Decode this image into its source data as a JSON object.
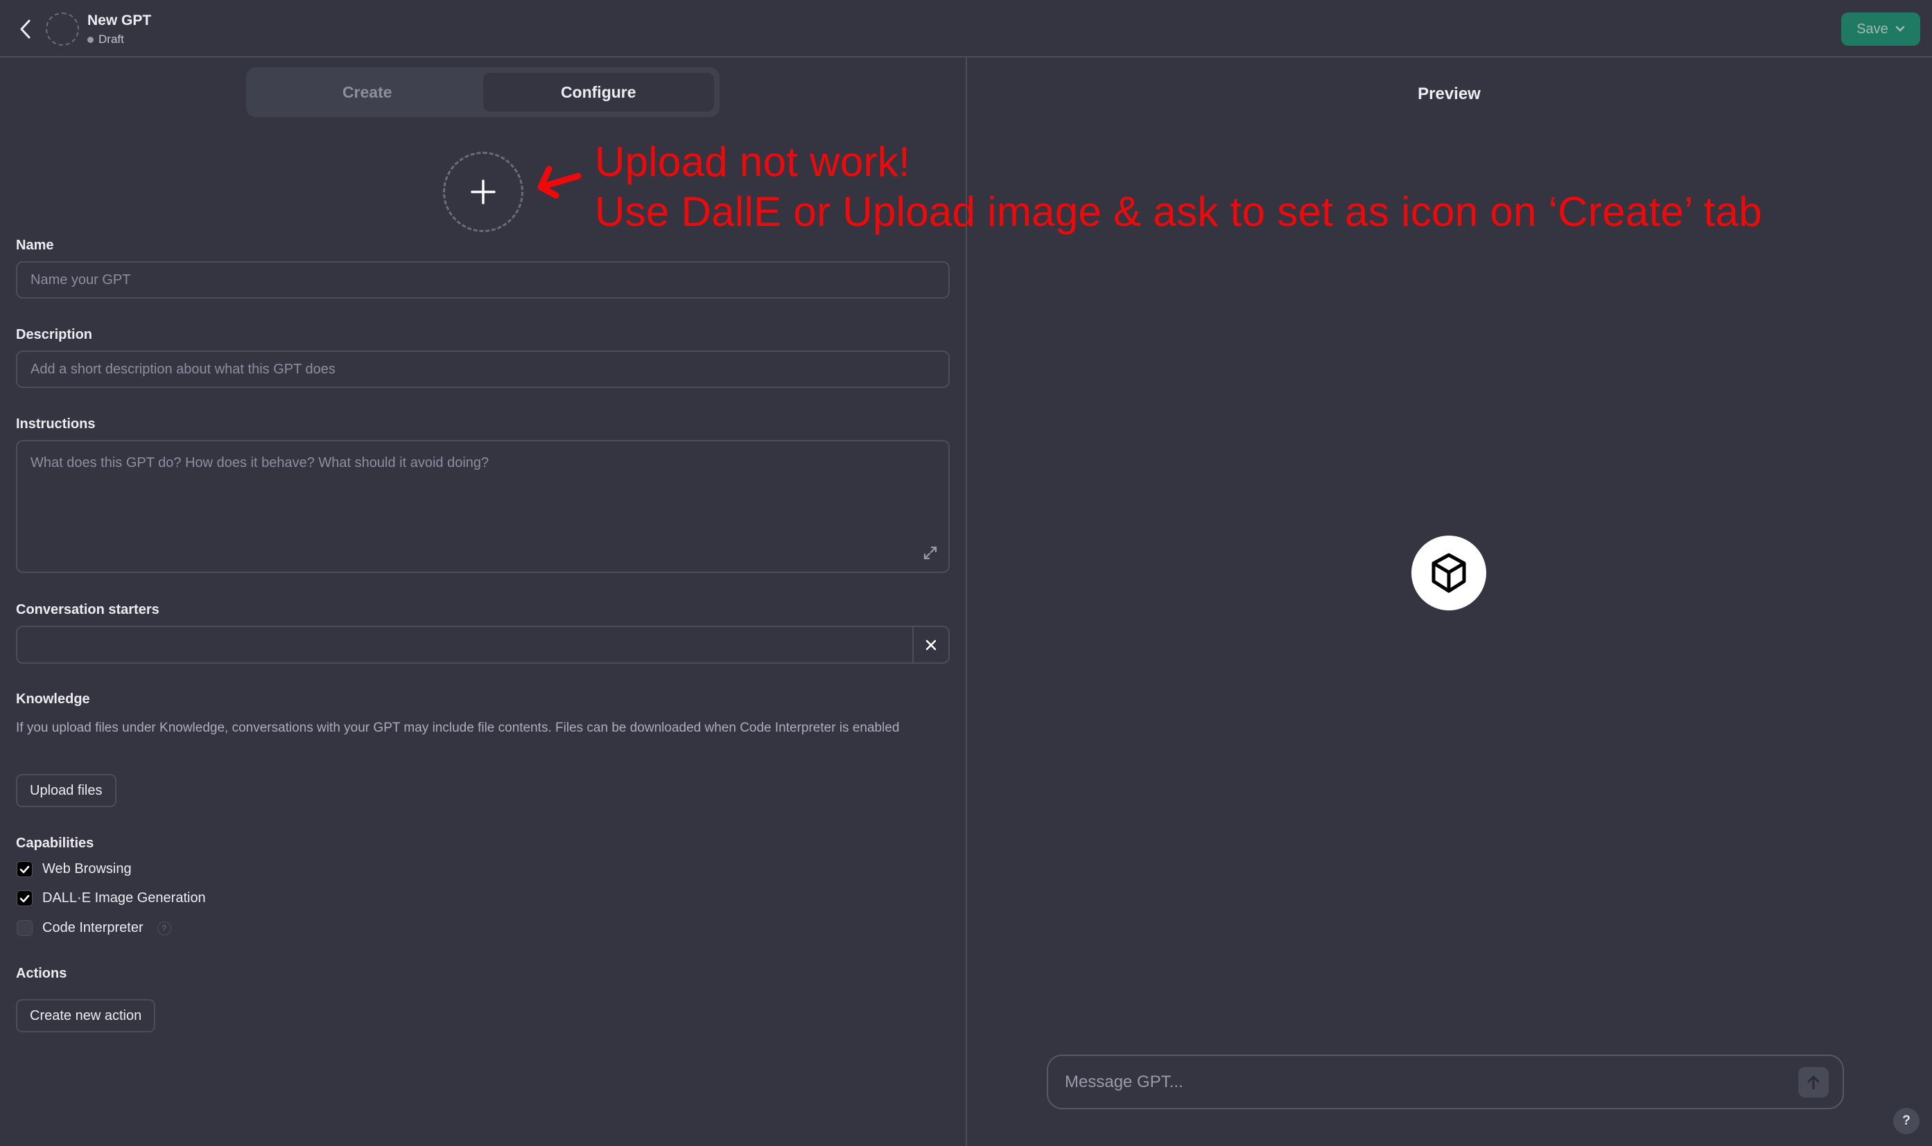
{
  "header": {
    "title": "New GPT",
    "status": "Draft",
    "save_label": "Save"
  },
  "tabs": [
    {
      "label": "Create",
      "active": false
    },
    {
      "label": "Configure",
      "active": true
    }
  ],
  "annotation": {
    "line1": "Upload not work!",
    "line2": "Use DallE or Upload image & ask to set as icon on ‘Create’ tab",
    "color": "#ee0a0a"
  },
  "form": {
    "name": {
      "label": "Name",
      "placeholder": "Name your GPT",
      "value": ""
    },
    "description": {
      "label": "Description",
      "placeholder": "Add a short description about what this GPT does",
      "value": ""
    },
    "instructions": {
      "label": "Instructions",
      "placeholder": "What does this GPT do? How does it behave? What should it avoid doing?",
      "value": ""
    },
    "conversation_starters": {
      "label": "Conversation starters",
      "items": [
        ""
      ]
    },
    "knowledge": {
      "label": "Knowledge",
      "description": "If you upload files under Knowledge, conversations with your GPT may include file contents. Files can be downloaded when Code Interpreter is enabled",
      "upload_label": "Upload files"
    },
    "capabilities": {
      "label": "Capabilities",
      "items": [
        {
          "label": "Web Browsing",
          "checked": true
        },
        {
          "label": "DALL·E Image Generation",
          "checked": true
        },
        {
          "label": "Code Interpreter",
          "checked": false,
          "help": "?"
        }
      ]
    },
    "actions": {
      "label": "Actions",
      "button_label": "Create new action"
    }
  },
  "preview": {
    "title": "Preview",
    "message_placeholder": "Message GPT...",
    "help_label": "?"
  },
  "colors": {
    "background": "#343541",
    "save_button": "#1f7a63",
    "border": "#4d4d5a"
  }
}
